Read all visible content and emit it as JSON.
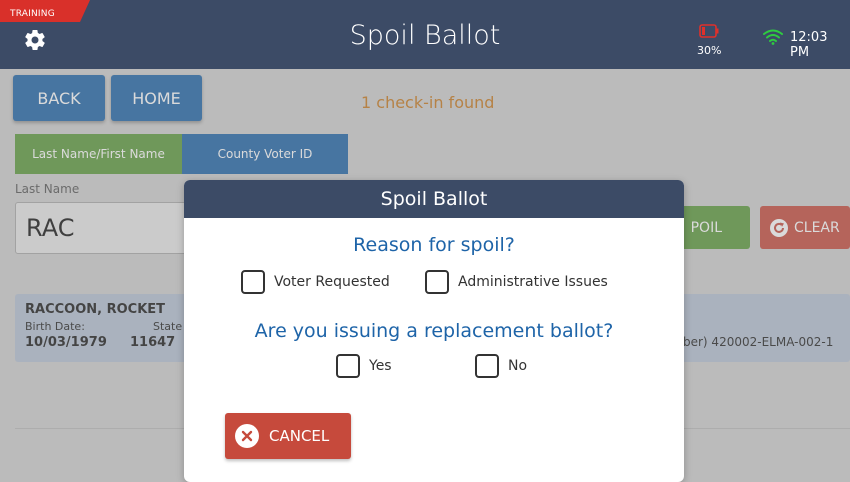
{
  "header": {
    "training_label": "TRAINING",
    "title": "Spoil Ballot",
    "battery_percent": "30%",
    "time": "12:03 PM",
    "icons": {
      "settings": "gear-icon",
      "battery": "battery-icon",
      "wifi": "wifi-icon"
    }
  },
  "nav": {
    "back_label": "BACK",
    "home_label": "HOME"
  },
  "status": {
    "found_text": "1 check-in found"
  },
  "search": {
    "tabs": [
      {
        "label": "Last Name/First Name"
      },
      {
        "label": "County Voter ID"
      }
    ],
    "field_label": "Last Name",
    "value": "RAC",
    "spoil_label": "POIL",
    "clear_label": "CLEAR"
  },
  "result": {
    "name": "RACCOON, ROCKET",
    "birth_date_label": "Birth Date:",
    "birth_date": "10/03/1979",
    "state_voter_label": "State V",
    "state_voter_value": "11647",
    "ballot_text": "ber) 420002-ELMA-002-1"
  },
  "modal": {
    "title": "Spoil Ballot",
    "reason_question": "Reason for spoil?",
    "reason_options": [
      {
        "label": "Voter Requested",
        "checked": false
      },
      {
        "label": "Administrative Issues",
        "checked": false
      }
    ],
    "replacement_question": "Are you issuing a replacement ballot?",
    "replacement_options": [
      {
        "label": "Yes",
        "checked": false
      },
      {
        "label": "No",
        "checked": false
      }
    ],
    "cancel_label": "CANCEL"
  },
  "colors": {
    "header_bg": "#3c4b66",
    "primary_blue": "#1e64a8",
    "success_green": "#5b9a3b",
    "danger_red": "#c64a3c",
    "notice_orange": "#c8781c",
    "battery_red": "#e0302a",
    "wifi_green": "#2ecc40"
  }
}
